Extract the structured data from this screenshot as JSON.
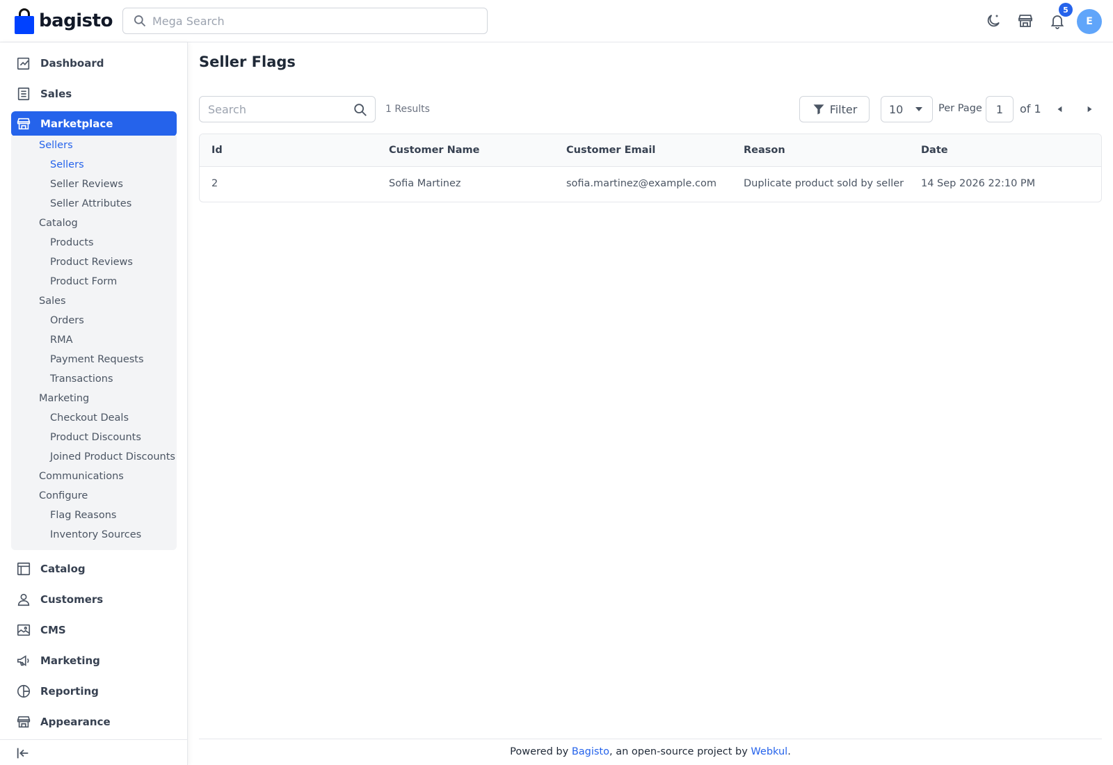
{
  "header": {
    "logo_text": "bagisto",
    "search_placeholder": "Mega Search",
    "notification_count": "5",
    "avatar_initial": "E"
  },
  "sidebar": {
    "items": [
      {
        "label": "Dashboard",
        "icon": "dashboard-icon"
      },
      {
        "label": "Sales",
        "icon": "receipt-icon"
      },
      {
        "label": "Marketplace",
        "icon": "store-icon",
        "active": true
      },
      {
        "label": "Catalog",
        "icon": "catalog-icon"
      },
      {
        "label": "Customers",
        "icon": "user-icon"
      },
      {
        "label": "CMS",
        "icon": "image-icon"
      },
      {
        "label": "Marketing",
        "icon": "megaphone-icon"
      },
      {
        "label": "Reporting",
        "icon": "chart-icon"
      },
      {
        "label": "Appearance",
        "icon": "store-icon"
      }
    ],
    "submenu": {
      "sellers": "Sellers",
      "sellers_sellers": "Sellers",
      "seller_reviews": "Seller Reviews",
      "seller_attributes": "Seller Attributes",
      "catalog": "Catalog",
      "products": "Products",
      "product_reviews": "Product Reviews",
      "product_form": "Product Form",
      "sales": "Sales",
      "orders": "Orders",
      "rma": "RMA",
      "payment_requests": "Payment Requests",
      "transactions": "Transactions",
      "marketing": "Marketing",
      "checkout_deals": "Checkout Deals",
      "product_discounts": "Product Discounts",
      "joined_product_discounts": "Joined Product Discounts",
      "communications": "Communications",
      "configure": "Configure",
      "flag_reasons": "Flag Reasons",
      "inventory_sources": "Inventory Sources"
    }
  },
  "main": {
    "title": "Seller Flags",
    "search_placeholder": "Search",
    "results_text": "1 Results",
    "filter_label": "Filter",
    "per_page_value": "10",
    "per_page_label": "Per Page",
    "current_page": "1",
    "total_pages_text": "of 1",
    "columns": [
      "Id",
      "Customer Name",
      "Customer Email",
      "Reason",
      "Date"
    ],
    "rows": [
      [
        "2",
        "Sofia Martinez",
        "sofia.martinez@example.com",
        "Duplicate product sold by seller",
        "14 Sep 2026 22:10 PM"
      ]
    ]
  },
  "footer": {
    "prefix": "Powered by ",
    "bagisto_link": "Bagisto",
    "middle": ", an open-source project by ",
    "webkul_link": "Webkul",
    "suffix": "."
  },
  "colors": {
    "accent": "#2563eb",
    "logo_blue": "#0041ff"
  }
}
